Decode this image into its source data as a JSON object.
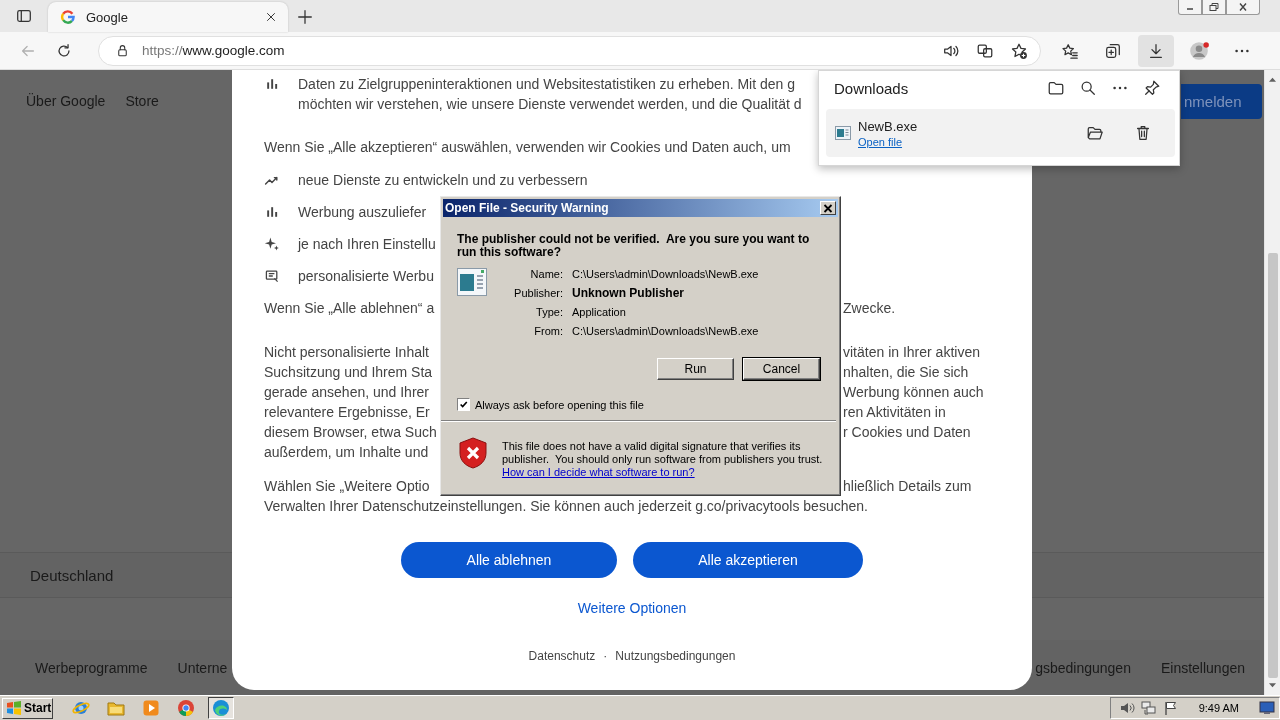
{
  "browser": {
    "tabs": [
      {
        "title": "Google",
        "selected": true
      }
    ],
    "address": {
      "scheme": "https://",
      "host": "www.google.com"
    },
    "address_actions": [
      {
        "kind": "read_aloud"
      },
      {
        "kind": "translate"
      },
      {
        "kind": "add_favorite"
      }
    ],
    "toolbar": [
      {
        "kind": "favorites",
        "selected": false
      },
      {
        "kind": "collections",
        "selected": false
      },
      {
        "kind": "downloads",
        "selected": true
      },
      {
        "kind": "profile",
        "selected": false
      },
      {
        "kind": "more",
        "selected": false
      }
    ]
  },
  "page": {
    "header_links": [
      "Über Google",
      "Store"
    ],
    "sign_in": "nmelden",
    "country": "Deutschland",
    "footer_left": [
      "Werbeprogramme",
      "Unterne"
    ],
    "footer_right": [
      "gsbedingungen",
      "Einstellungen"
    ]
  },
  "consent": {
    "blocks": [
      {
        "kind": "bars",
        "lines": [
          {
            "left": "Daten zu Zielgruppeninteraktionen und Websitestatistiken zu erheben. Mit den g"
          },
          {
            "left": "möchten wir verstehen, wie unsere Dienste verwendet werden, und die Qualität d"
          }
        ]
      },
      {
        "kind": "text",
        "lines": [
          {
            "left": "Wenn Sie „Alle akzeptieren“ auswählen, verwenden wir Cookies und Daten auch, um"
          }
        ]
      },
      {
        "kind": "trend",
        "lines": [
          {
            "left": "neue Dienste zu entwickeln und zu verbessern"
          }
        ]
      },
      {
        "kind": "bars",
        "lines": [
          {
            "left": "Werbung auszuliefer"
          }
        ]
      },
      {
        "kind": "sparkle",
        "lines": [
          {
            "left": "je nach Ihren Einstellu"
          }
        ]
      },
      {
        "kind": "news",
        "lines": [
          {
            "left": "personalisierte Werbu"
          }
        ]
      },
      {
        "kind": "text",
        "lines": [
          {
            "left": "Wenn Sie „Alle ablehnen“ a",
            "right": "Zwecke."
          }
        ]
      },
      {
        "kind": "text",
        "lines": [
          {
            "left": "Nicht personalisierte Inhalt",
            "right": "vitäten in Ihrer aktiven"
          },
          {
            "left": "Suchsitzung und Ihrem Sta",
            "right": "nhalten, die Sie sich"
          },
          {
            "left": "gerade ansehen, und Ihrer",
            "right": "Werbung können auch"
          },
          {
            "left": "relevantere Ergebnisse, Er",
            "right": "ren Aktivitäten in"
          },
          {
            "left": "diesem Browser, etwa Such",
            "right": "r Cookies und Daten"
          },
          {
            "left": "außerdem, um Inhalte und"
          }
        ]
      },
      {
        "kind": "text",
        "lines": [
          {
            "left": "Wählen Sie „Weitere Optio",
            "right": "hließlich Details zum"
          },
          {
            "left": "Verwalten Ihrer Datenschutzeinstellungen. Sie können auch jederzeit g.co/privacytools besuchen."
          }
        ]
      }
    ],
    "buttons": [
      "Alle ablehnen",
      "Alle akzeptieren"
    ],
    "more_link": "Weitere Optionen",
    "footer_links": [
      "Datenschutz",
      "Nutzungsbedingungen"
    ],
    "footer_separator": "·"
  },
  "dialog": {
    "title": "Open File - Security Warning",
    "question": "The publisher could not be verified.  Are you sure you want to run this software?",
    "fields": [
      {
        "label": "Name:",
        "value": "C:\\Users\\admin\\Downloads\\NewB.exe",
        "emphasized": false
      },
      {
        "label": "Publisher:",
        "value": "Unknown Publisher",
        "emphasized": true
      },
      {
        "label": "Type:",
        "value": "Application",
        "emphasized": false
      },
      {
        "label": "From:",
        "value": "C:\\Users\\admin\\Downloads\\NewB.exe",
        "emphasized": false
      }
    ],
    "buttons": [
      {
        "label": "Run",
        "default": false
      },
      {
        "label": "Cancel",
        "default": true
      }
    ],
    "checkbox": {
      "label": "Always ask before opening this file",
      "checked": true
    },
    "warning": "This file does not have a valid digital signature that verifies its publisher.  You should only run software from publishers you trust.",
    "help_link": "How can I decide what software to run?"
  },
  "downloads": {
    "title": "Downloads",
    "items": [
      {
        "name": "NewB.exe",
        "action": "Open file"
      }
    ]
  },
  "taskbar": {
    "start": "Start",
    "apps": [
      {
        "kind": "ie",
        "selected": false
      },
      {
        "kind": "explorer",
        "selected": false
      },
      {
        "kind": "media",
        "selected": false
      },
      {
        "kind": "chrome",
        "selected": false
      },
      {
        "kind": "edge",
        "selected": true
      }
    ],
    "clock": "9:49 AM"
  }
}
